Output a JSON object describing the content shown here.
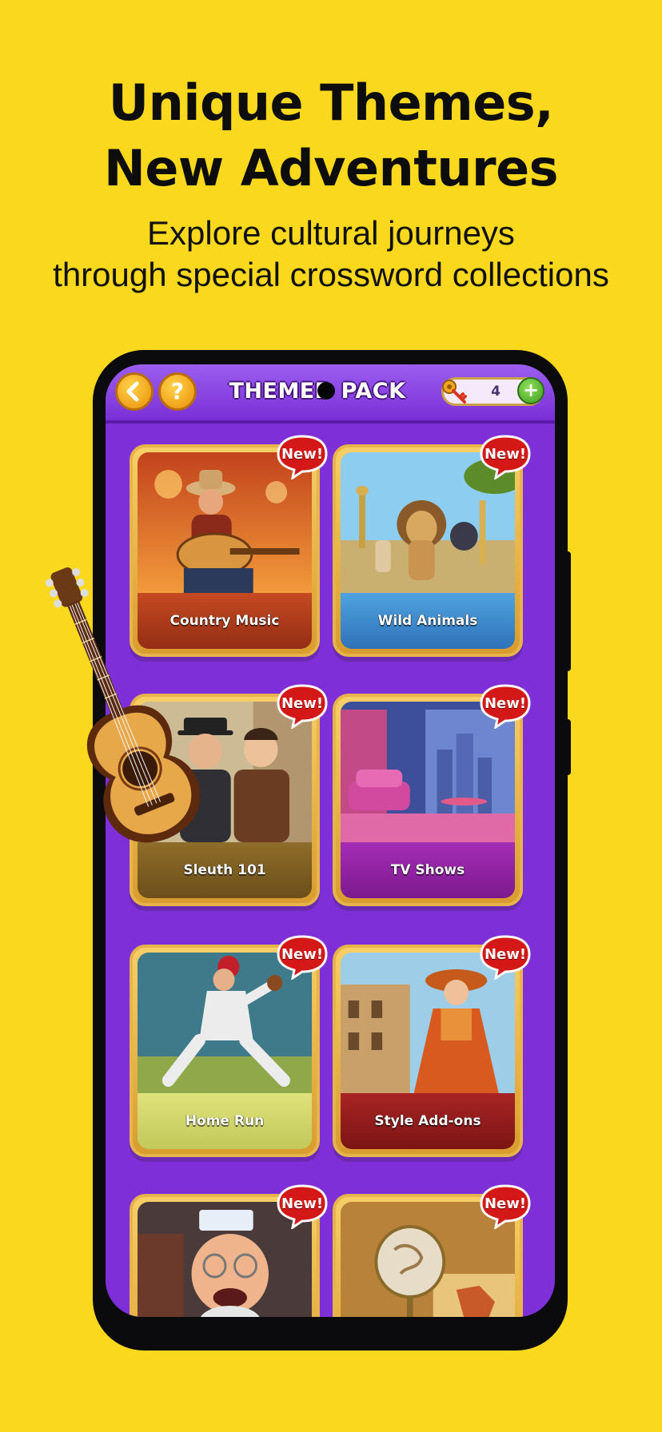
{
  "promo": {
    "headline_line1": "Unique Themes,",
    "headline_line2": "New Adventures",
    "subline_line1": "Explore cultural journeys",
    "subline_line2": "through special crossword collections"
  },
  "app": {
    "title": "THEMED PACK",
    "back_icon": "chevron-left-icon",
    "help_label": "?",
    "keys_count": "4",
    "add_label": "+"
  },
  "colors": {
    "background": "#F9D81E",
    "screen": "#7f2fd8",
    "card_frame": "#e6b44a",
    "badge": "#d41818"
  },
  "badge_label": "New!",
  "packs": [
    {
      "label": "Country Music",
      "band": "#b43d1e"
    },
    {
      "label": "Wild Animals",
      "band": "#3e8cd0"
    },
    {
      "label": "Sleuth 101",
      "band": "#7d5e22"
    },
    {
      "label": "TV Shows",
      "band": "#8d1f9a"
    },
    {
      "label": "Home Run",
      "band": "#cfd36a"
    },
    {
      "label": "Style Add-ons",
      "band": "#8a1a1a"
    },
    {
      "label": "",
      "band": "#6b4a2a"
    },
    {
      "label": "",
      "band": "#b07a30"
    }
  ]
}
